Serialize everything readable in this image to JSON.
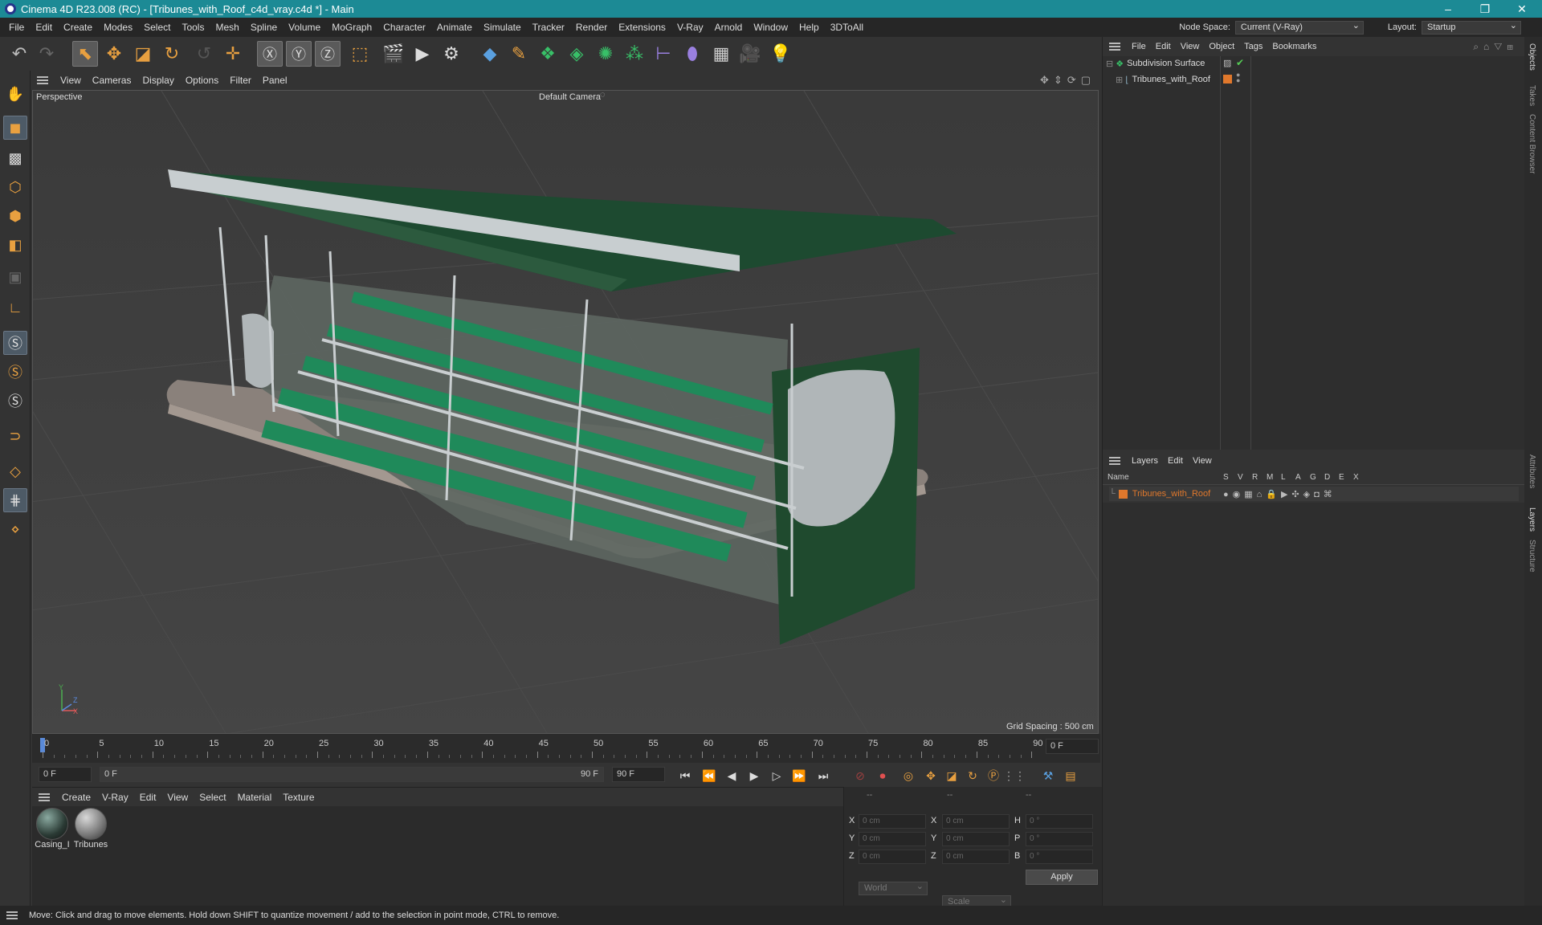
{
  "window": {
    "title": "Cinema 4D R23.008 (RC) - [Tribunes_with_Roof_c4d_vray.c4d *] - Main",
    "controls": [
      "–",
      "❐",
      "✕"
    ]
  },
  "menubar": {
    "items": [
      "File",
      "Edit",
      "Create",
      "Modes",
      "Select",
      "Tools",
      "Mesh",
      "Spline",
      "Volume",
      "MoGraph",
      "Character",
      "Animate",
      "Simulate",
      "Tracker",
      "Render",
      "Extensions",
      "V-Ray",
      "Arnold",
      "Window",
      "Help",
      "3DToAll"
    ],
    "node_space_label": "Node Space:",
    "node_space_value": "Current (V-Ray)",
    "layout_label": "Layout:",
    "layout_value": "Startup"
  },
  "viewport": {
    "menu": [
      "View",
      "Cameras",
      "Display",
      "Options",
      "Filter",
      "Panel"
    ],
    "view_name": "Perspective",
    "camera": "Default Camera",
    "grid_spacing": "Grid Spacing : 500 cm",
    "axis_y": "Y",
    "axis_z": "Z",
    "axis_x": "X"
  },
  "timeline": {
    "ticks": [
      "0",
      "5",
      "10",
      "15",
      "20",
      "25",
      "30",
      "35",
      "40",
      "45",
      "50",
      "55",
      "60",
      "65",
      "70",
      "75",
      "80",
      "85",
      "90"
    ],
    "current_frame": "0 F"
  },
  "playback": {
    "start": "0 F",
    "range_start": "0 F",
    "range_end": "90 F",
    "end": "90 F"
  },
  "materials": {
    "menu": [
      "Create",
      "V-Ray",
      "Edit",
      "View",
      "Select",
      "Material",
      "Texture"
    ],
    "items": [
      {
        "name": "Casing_I"
      },
      {
        "name": "Tribunes"
      }
    ]
  },
  "coordinates": {
    "headers": [
      "--",
      "--",
      "--"
    ],
    "rows": [
      {
        "l1": "X",
        "v1": "0 cm",
        "l2": "X",
        "v2": "0 cm",
        "l3": "H",
        "v3": "0 °"
      },
      {
        "l1": "Y",
        "v1": "0 cm",
        "l2": "Y",
        "v2": "0 cm",
        "l3": "P",
        "v3": "0 °"
      },
      {
        "l1": "Z",
        "v1": "0 cm",
        "l2": "Z",
        "v2": "0 cm",
        "l3": "B",
        "v3": "0 °"
      }
    ],
    "mode": "World",
    "transform": "Scale",
    "apply": "Apply"
  },
  "objects": {
    "menu": [
      "File",
      "Edit",
      "View",
      "Object",
      "Tags",
      "Bookmarks"
    ],
    "items": [
      {
        "name": "Subdivision Surface"
      },
      {
        "name": "Tribunes_with_Roof"
      }
    ]
  },
  "layers": {
    "menu": [
      "Layers",
      "Edit",
      "View"
    ],
    "columns": [
      "Name",
      "S",
      "V",
      "R",
      "M",
      "L",
      "A",
      "G",
      "D",
      "E",
      "X"
    ],
    "items": [
      {
        "name": "Tribunes_with_Roof",
        "color": "#e0782c"
      }
    ]
  },
  "side_tabs": [
    "Objects",
    "Takes",
    "Content Browser",
    "Attributes",
    "Layers",
    "Structure"
  ],
  "status": "Move: Click and drag to move elements. Hold down SHIFT to quantize movement / add to the selection in point mode, CTRL to remove.",
  "colors": {
    "titlebar": "#1c8a95",
    "accent_orange": "#e0782c",
    "seat_green": "#1f8a5a",
    "roof_green": "#1d4a30"
  }
}
